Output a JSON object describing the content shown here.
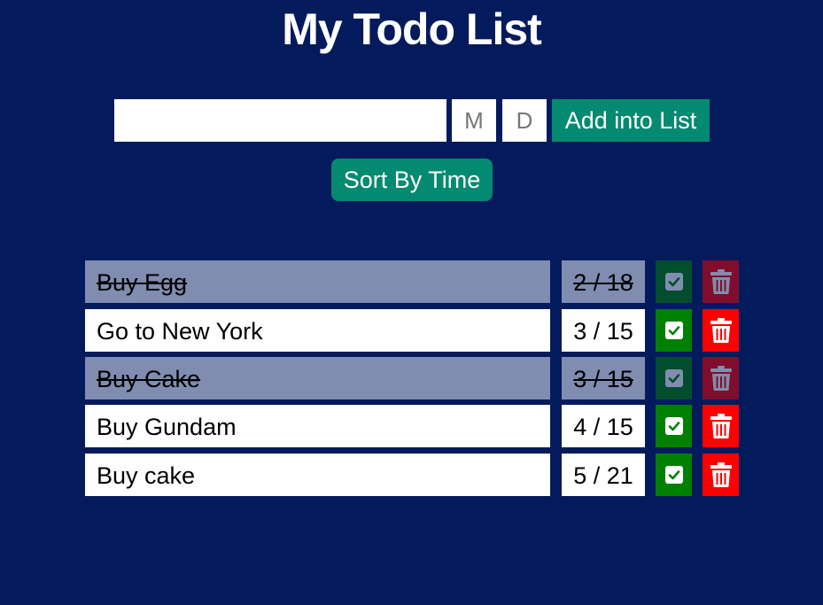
{
  "app": {
    "title": "My Todo List"
  },
  "form": {
    "todo_input_value": "",
    "month_placeholder": "M",
    "day_placeholder": "D",
    "add_button_label": "Add into List"
  },
  "sort_button_label": "Sort By Time",
  "todos": [
    {
      "text": "Buy Egg",
      "date": "2 / 18",
      "completed": true
    },
    {
      "text": "Go to New York",
      "date": "3 / 15",
      "completed": false
    },
    {
      "text": "Buy Cake",
      "date": "3 / 15",
      "completed": true
    },
    {
      "text": "Buy Gundam",
      "date": "4 / 15",
      "completed": false
    },
    {
      "text": "Buy cake",
      "date": "5 / 21",
      "completed": false
    }
  ],
  "icons": {
    "done": "check-square-icon",
    "delete": "trash-icon"
  },
  "colors": {
    "background": "#031b5c",
    "accent": "#048a70",
    "done": "#008000",
    "delete": "#ff0000",
    "completed_row": "#808cb0"
  }
}
